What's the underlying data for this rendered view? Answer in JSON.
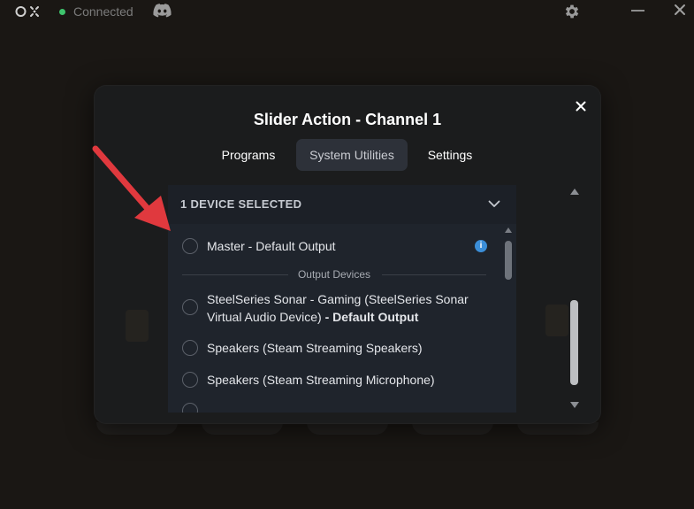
{
  "topbar": {
    "status": "Connected",
    "status_color": "#3ec46d",
    "icons": [
      "app-logo-icon",
      "discord-icon",
      "gear-icon",
      "minimize-icon",
      "close-icon"
    ]
  },
  "modal": {
    "title": "Slider Action - Channel 1",
    "tabs": [
      {
        "label": "Programs",
        "active": false
      },
      {
        "label": "System Utilities",
        "active": true
      },
      {
        "label": "Settings",
        "active": false
      }
    ],
    "dropdown": {
      "header": "1 DEVICE SELECTED",
      "items": [
        {
          "label": "Master - Default Output",
          "info": "i"
        },
        {
          "section": "Output Devices"
        },
        {
          "label_line1": "SteelSeries Sonar - Gaming (SteelSeries Sonar",
          "label_line2": "Virtual Audio Device)",
          "label_suffix": "- Default Output"
        },
        {
          "label": "Speakers (Steam Streaming Speakers)"
        },
        {
          "label": "Speakers (Steam Streaming Microphone)"
        }
      ]
    }
  },
  "accent": {
    "info_blue": "#3b8ed8",
    "annotation_red": "#e0393e"
  }
}
